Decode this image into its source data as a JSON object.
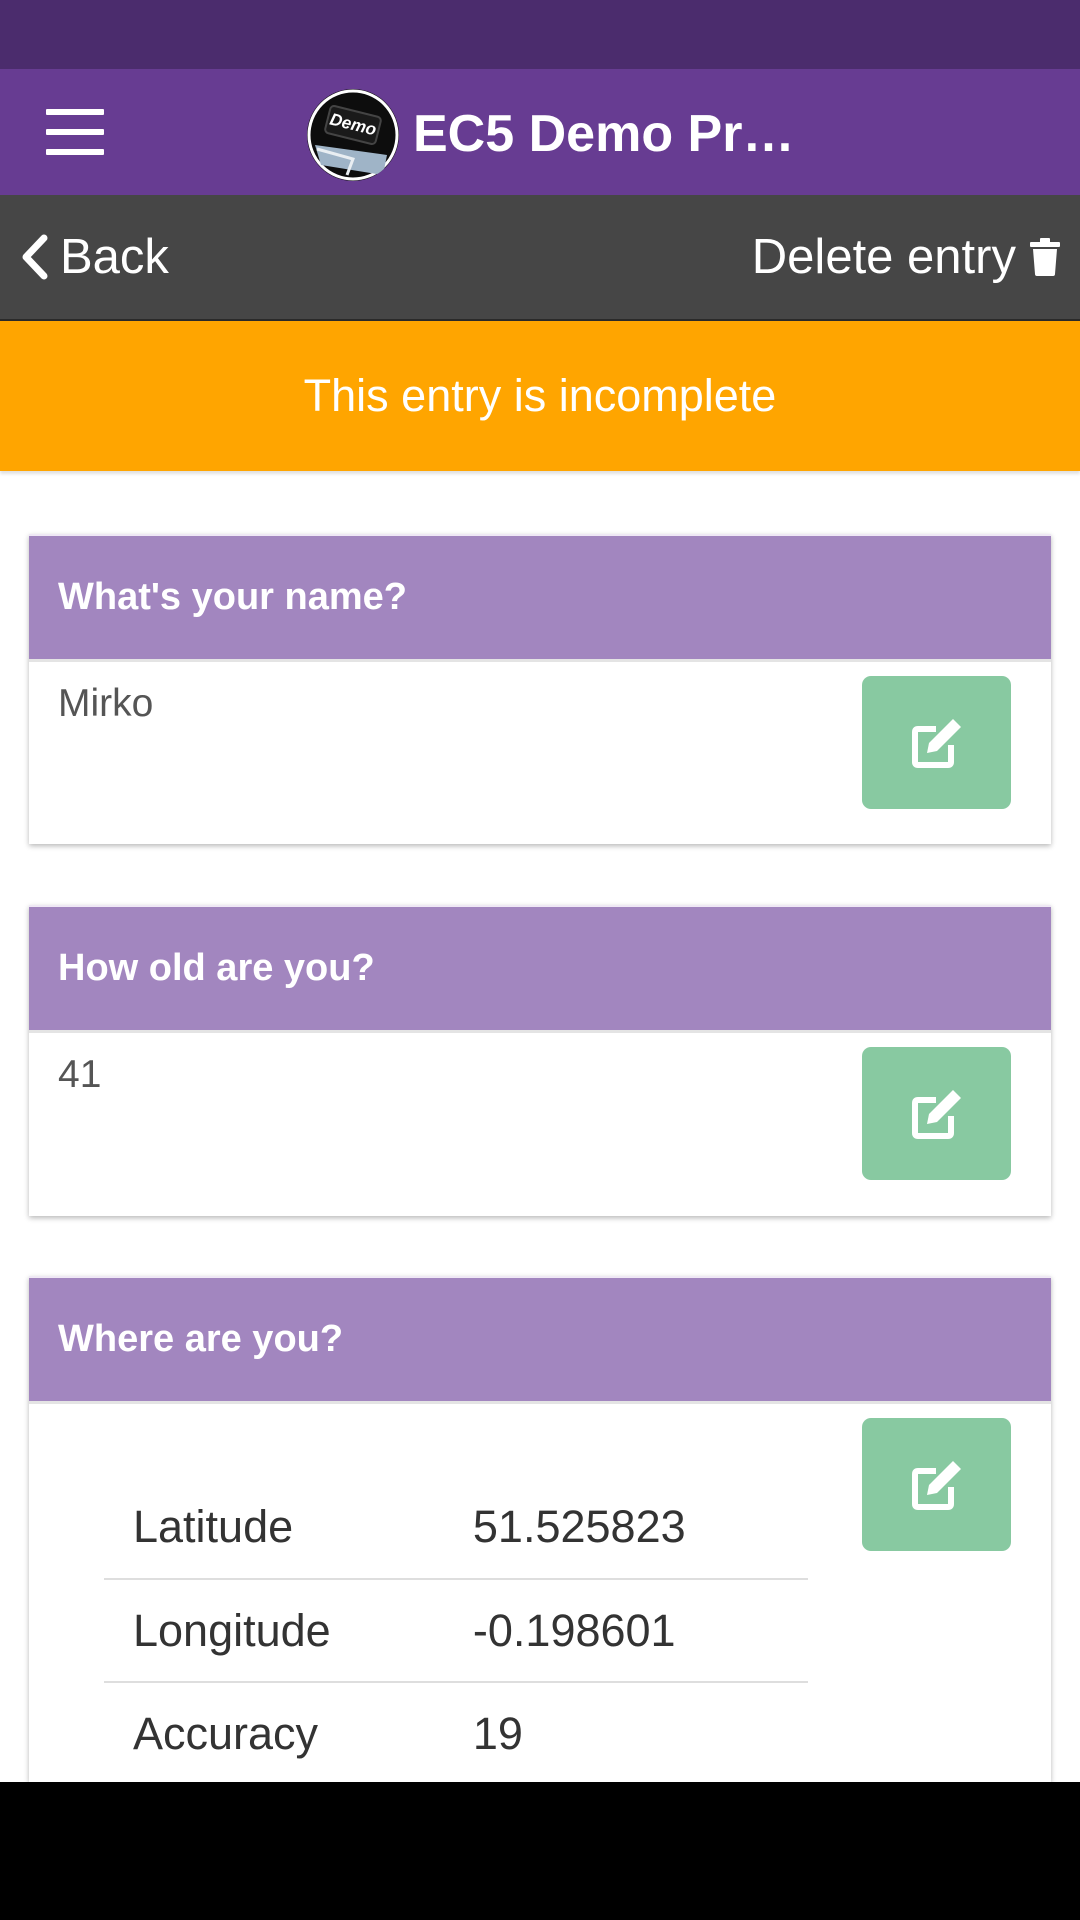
{
  "app_bar": {
    "title": "EC5 Demo Pr…",
    "logo_text": "Demo"
  },
  "nav_bar": {
    "back_label": "Back",
    "delete_label": "Delete entry"
  },
  "banner": {
    "text": "This entry is incomplete"
  },
  "questions": [
    {
      "question": "What's your name?",
      "answer": "Mirko"
    },
    {
      "question": "How old are you?",
      "answer": "41"
    },
    {
      "question": "Where are you?",
      "location": [
        {
          "label": "Latitude",
          "value": "51.525823"
        },
        {
          "label": "Longitude",
          "value": "-0.198601"
        },
        {
          "label": "Accuracy",
          "value": "19"
        }
      ]
    }
  ],
  "colors": {
    "status_bar": "#4b2c6d",
    "app_bar": "#673c92",
    "nav_bar": "#464646",
    "banner": "#ffa500",
    "card_header": "#a286bf",
    "edit_button": "#88c9a1"
  },
  "icons": {
    "menu": "hamburger-icon",
    "back": "chevron-left-icon",
    "delete": "trash-icon",
    "edit": "edit-icon"
  }
}
